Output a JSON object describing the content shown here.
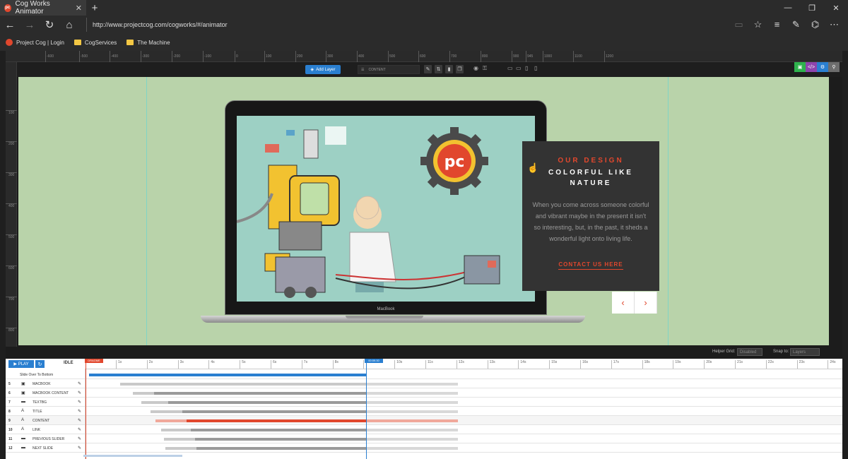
{
  "browser": {
    "tab_title": "Cog Works Animator",
    "tab_close": "✕",
    "new_tab": "+",
    "url": "http://www.projectcog.com/cogworks/#/animator",
    "window_controls": [
      "—",
      "❐",
      "✕"
    ],
    "favorites": [
      {
        "label": "Project Cog | Login",
        "icon": "pc-favicon"
      },
      {
        "label": "CogServices",
        "icon": "folder-icon"
      },
      {
        "label": "The Machine",
        "icon": "folder-icon"
      }
    ]
  },
  "ruler": {
    "h_ticks": [
      "-600",
      "-500",
      "-400",
      "-300",
      "-200",
      "-100",
      "0",
      "100",
      "200",
      "300",
      "400",
      "500",
      "600",
      "700",
      "800",
      "900",
      "945",
      "1000",
      "1100",
      "1200"
    ],
    "v_ticks": [
      "100",
      "200",
      "300",
      "400",
      "500",
      "600",
      "700",
      "800"
    ]
  },
  "toolbar": {
    "add_layer": "Add Layer",
    "layer_select": "CONTENT"
  },
  "slide": {
    "title": "OUR DESIGN",
    "subtitle": "COLORFUL LIKE NATURE",
    "body": "When you come across someone colorful and vibrant maybe in the present it isn't so interesting, but, in the past, it sheds a wonderful light onto living life.",
    "link": "CONTACT US HERE",
    "laptop_brand": "MacBook",
    "prev": "‹",
    "next": "›",
    "logo_text": "pc"
  },
  "grid": {
    "helper_label": "Helper Grid:",
    "helper_value": "Disabled",
    "snap_label": "Snap to:",
    "snap_value": "Layers"
  },
  "timeline": {
    "play": "PLAY",
    "status": "IDLE",
    "dragme": "DRAGME",
    "playhead": "00:09.00",
    "ticks": [
      "1s",
      "2s",
      "3s",
      "4s",
      "5s",
      "6s",
      "7s",
      "8s",
      "",
      "10s",
      "11s",
      "12s",
      "13s",
      "14s",
      "15s",
      "16s",
      "17s",
      "18s",
      "19s",
      "20s",
      "21s",
      "22s",
      "23s",
      "24s"
    ],
    "rows": [
      {
        "num": "",
        "name": "Slide Over To Bottom",
        "type": "slide"
      },
      {
        "num": "5",
        "name": "MACBOOK",
        "type": "image"
      },
      {
        "num": "6",
        "name": "MACBOOK CONTENT",
        "type": "image"
      },
      {
        "num": "7",
        "name": "TEXTBG",
        "type": "shape"
      },
      {
        "num": "8",
        "name": "TITLE",
        "type": "text"
      },
      {
        "num": "9",
        "name": "CONTENT",
        "type": "text",
        "active": true
      },
      {
        "num": "10",
        "name": "LINK",
        "type": "text"
      },
      {
        "num": "11",
        "name": "PREVIOUS SLIDER",
        "type": "shape"
      },
      {
        "num": "12",
        "name": "NEXT SLIDE",
        "type": "shape"
      }
    ]
  },
  "colors": {
    "accent": "#e1472d",
    "blue": "#2a7fd0",
    "stage_bg": "#b9d3aa",
    "screen_bg": "#9dd0c4"
  }
}
